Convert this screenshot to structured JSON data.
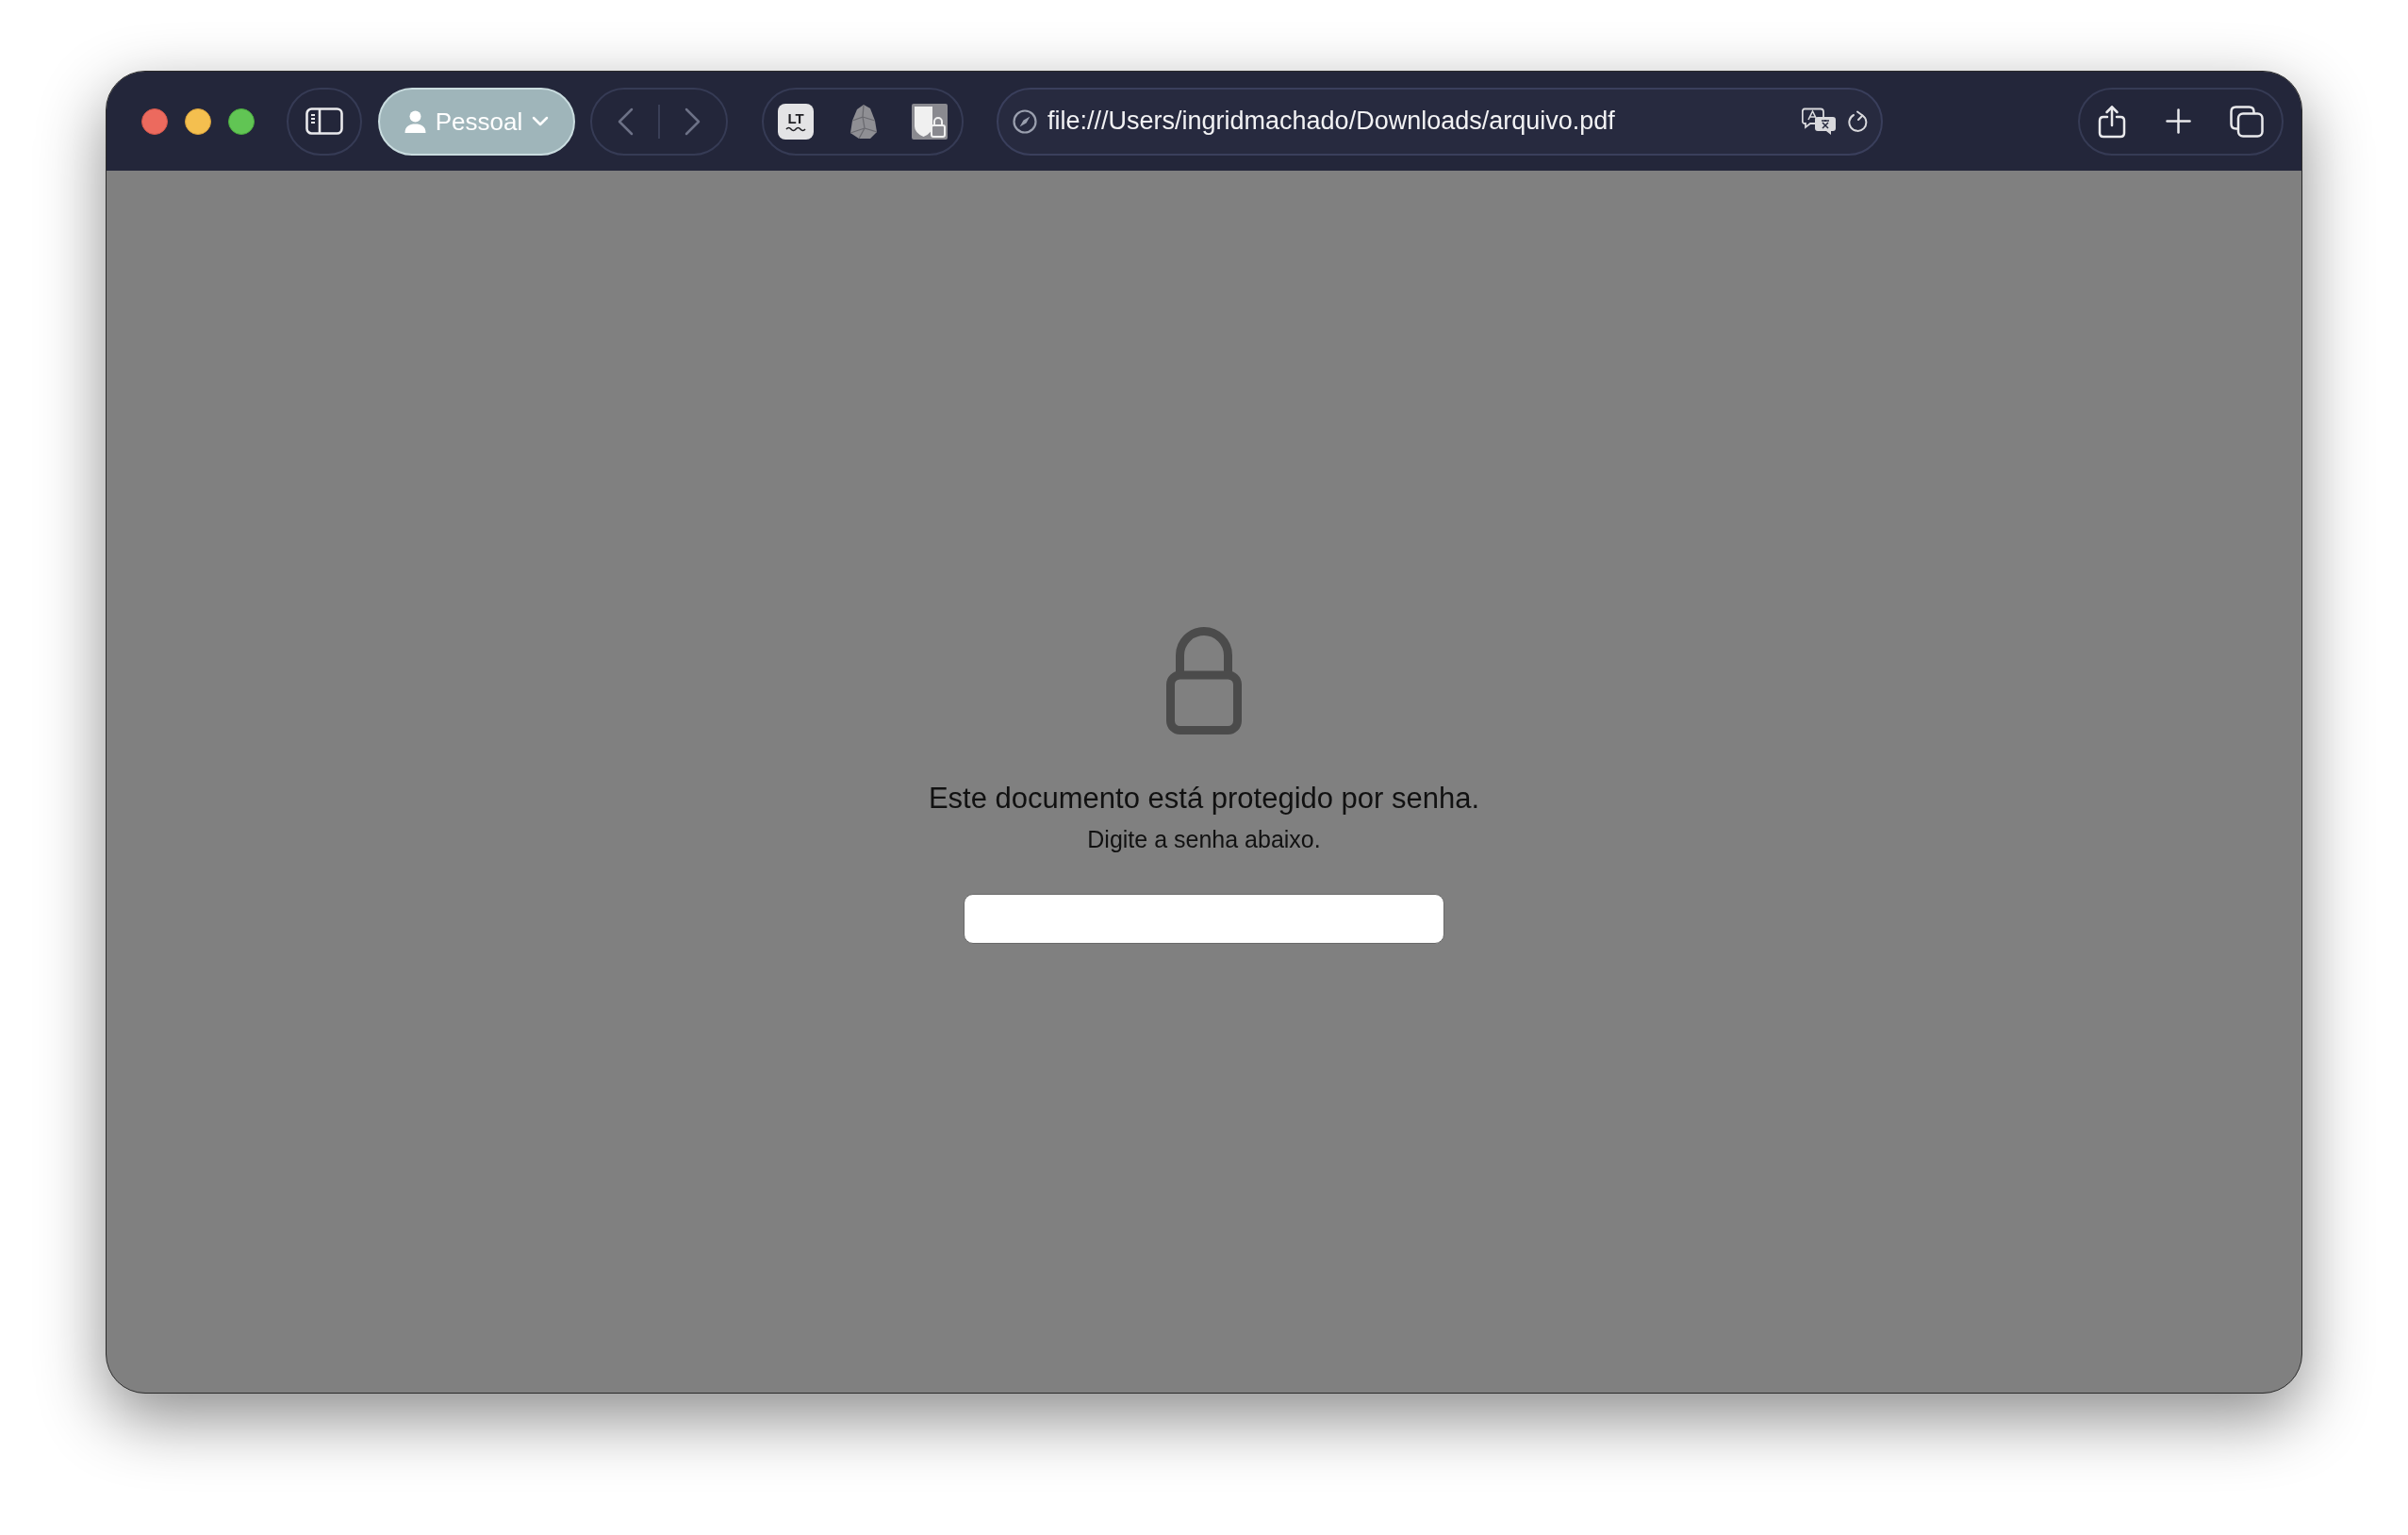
{
  "toolbar": {
    "profile_button": {
      "label": "Pessoal"
    },
    "nav_buttons": [
      {
        "kind": "back",
        "disabled": true
      },
      {
        "kind": "forward",
        "disabled": true
      }
    ],
    "extensions": [
      {
        "kind": "text-tile",
        "label": "LT"
      },
      {
        "kind": "rock"
      },
      {
        "kind": "locked-page"
      }
    ],
    "address_bar": {
      "url": "file:///Users/ingridmachado/Downloads/arquivo.pdf"
    }
  },
  "password_prompt": {
    "title": "Este documento está protegido por senha.",
    "subtitle": "Digite a senha abaixo."
  }
}
